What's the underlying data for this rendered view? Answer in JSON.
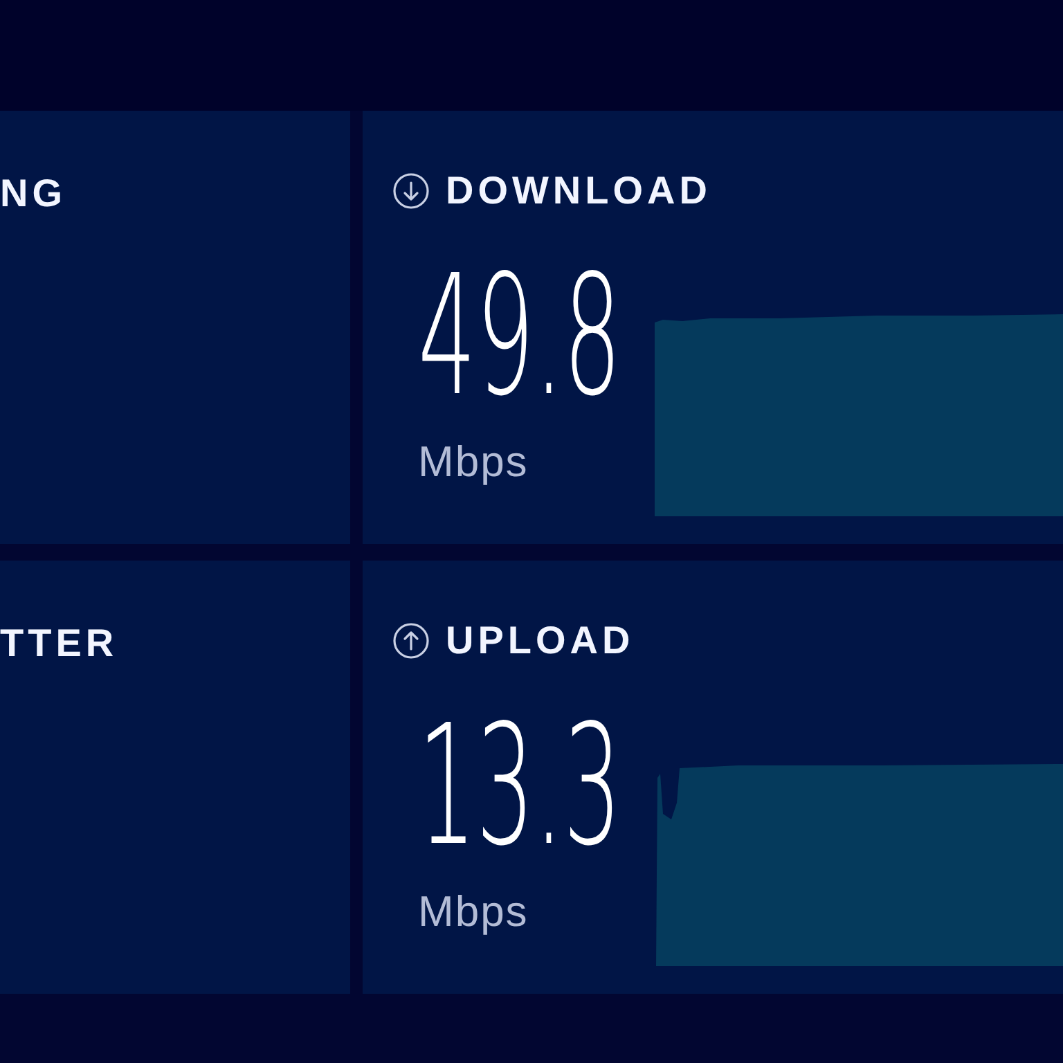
{
  "panels": [
    {
      "kind": "partial",
      "label": "NG"
    },
    {
      "kind": "download",
      "label": "DOWNLOAD",
      "value": "49.8",
      "unit": "Mbps"
    },
    {
      "kind": "partial",
      "label": "TTER"
    },
    {
      "kind": "upload",
      "label": "UPLOAD",
      "value": "13.3",
      "unit": "Mbps"
    }
  ]
}
